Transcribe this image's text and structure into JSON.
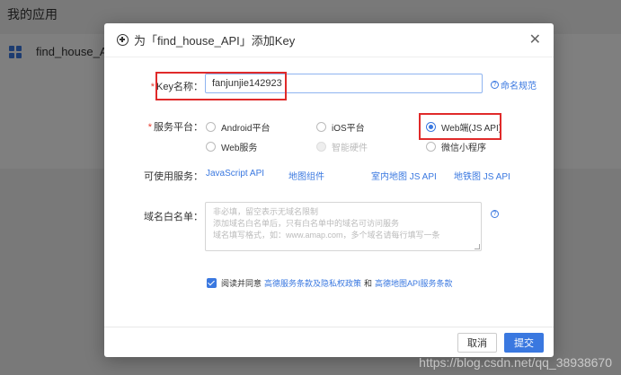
{
  "background": {
    "page_title": "我的应用",
    "app_name": "find_house_AP"
  },
  "modal": {
    "title": "为「find_house_API」添加Key",
    "key_name": {
      "label": "Key名称：",
      "required_mark": "*",
      "value": "fanjunjie142923"
    },
    "naming_rule_link": "命名规范",
    "service_platform": {
      "label": "服务平台：",
      "required_mark": "*",
      "options": [
        {
          "label": "Android平台",
          "selected": false,
          "disabled": false
        },
        {
          "label": "iOS平台",
          "selected": false,
          "disabled": false
        },
        {
          "label": "Web端(JS API)",
          "selected": true,
          "disabled": false
        },
        {
          "label": "Web服务",
          "selected": false,
          "disabled": false
        },
        {
          "label": "智能硬件",
          "selected": false,
          "disabled": true
        },
        {
          "label": "微信小程序",
          "selected": false,
          "disabled": false
        }
      ]
    },
    "available_services": {
      "label": "可使用服务：",
      "items": [
        "JavaScript API",
        "地图组件",
        "室内地图 JS API",
        "地铁图 JS API"
      ]
    },
    "domain_whitelist": {
      "label": "域名白名单：",
      "placeholder_lines": [
        "非必填，留空表示无域名限制",
        "添加域名白名单后，只有白名单中的域名可访问服务",
        "域名填写格式，如：www.amap.com，多个域名请每行填写一条"
      ]
    },
    "agreement": {
      "prefix": "阅读并同意",
      "link1": "高德服务条款及隐私权政策",
      "conjunction": "和",
      "link2": "高德地图API服务条款",
      "checked": true
    },
    "cancel_label": "取消",
    "submit_label": "提交"
  },
  "watermark": "https://blog.csdn.net/qq_38938670",
  "colors": {
    "accent": "#3a78e0",
    "highlight_box": "#e02a2a",
    "required": "#e63b2e"
  }
}
